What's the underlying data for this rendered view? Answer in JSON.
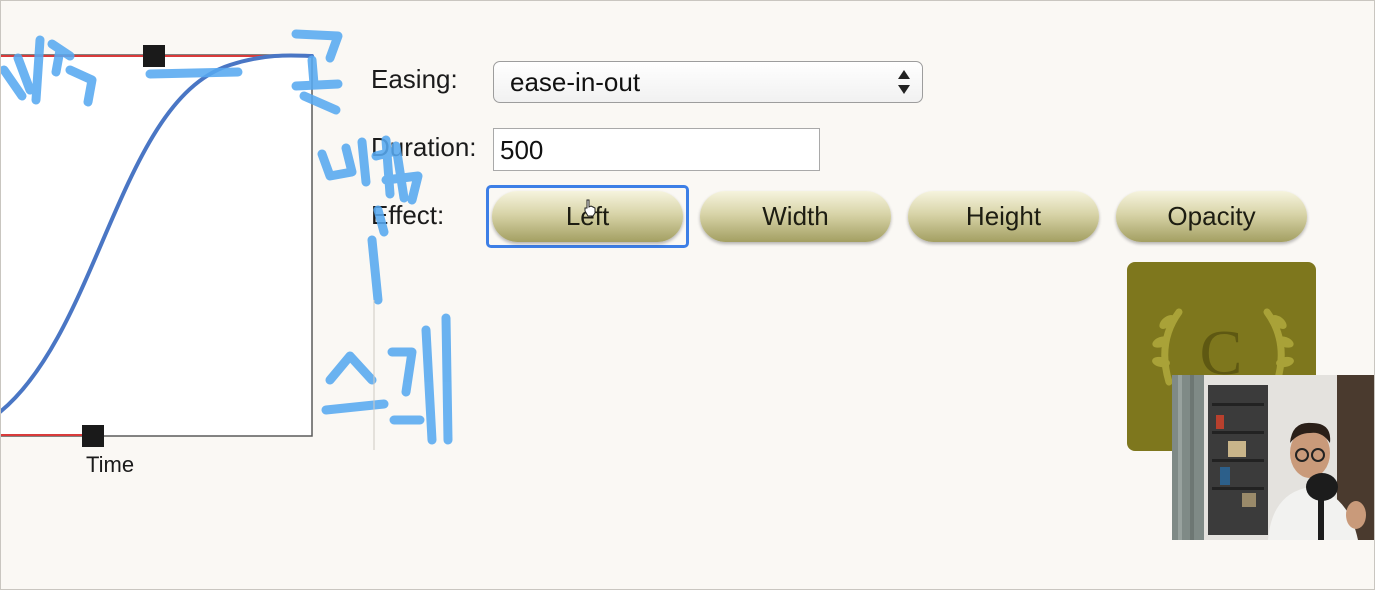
{
  "graph": {
    "time_label": "Time",
    "colors": {
      "curve": "#4a76c4",
      "guide": "#d93b3b",
      "frame": "#555555"
    }
  },
  "form": {
    "easing_label": "Easing:",
    "easing_value": "ease-in-out",
    "duration_label": "Duration:",
    "duration_value": "500",
    "effect_label": "Effect:"
  },
  "effects": {
    "left": "Left",
    "width": "Width",
    "height": "Height",
    "opacity": "Opacity",
    "focused": "Left"
  },
  "box": {
    "letter": "C",
    "color": "#7e771d"
  },
  "annotations": {
    "color": "#57a9f0"
  }
}
